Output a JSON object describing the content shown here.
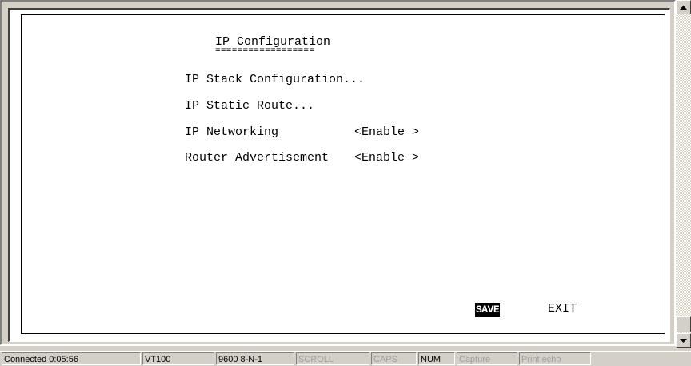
{
  "screen": {
    "title": "IP Configuration",
    "title_underline": "==================",
    "menu": [
      {
        "label": "IP Stack Configuration..."
      },
      {
        "label": "IP Static Route..."
      },
      {
        "label": "IP Networking",
        "value": "<Enable >"
      },
      {
        "label": "Router Advertisement",
        "value": "<Enable >"
      }
    ],
    "actions": {
      "save": "SAVE",
      "exit": "EXIT"
    }
  },
  "status_bar": {
    "connection": "Connected 0:05:56",
    "emulation": "VT100",
    "port_settings": "9600 8-N-1",
    "scroll": "SCROLL",
    "caps": "CAPS",
    "num": "NUM",
    "capture": "Capture",
    "print_echo": "Print echo"
  }
}
